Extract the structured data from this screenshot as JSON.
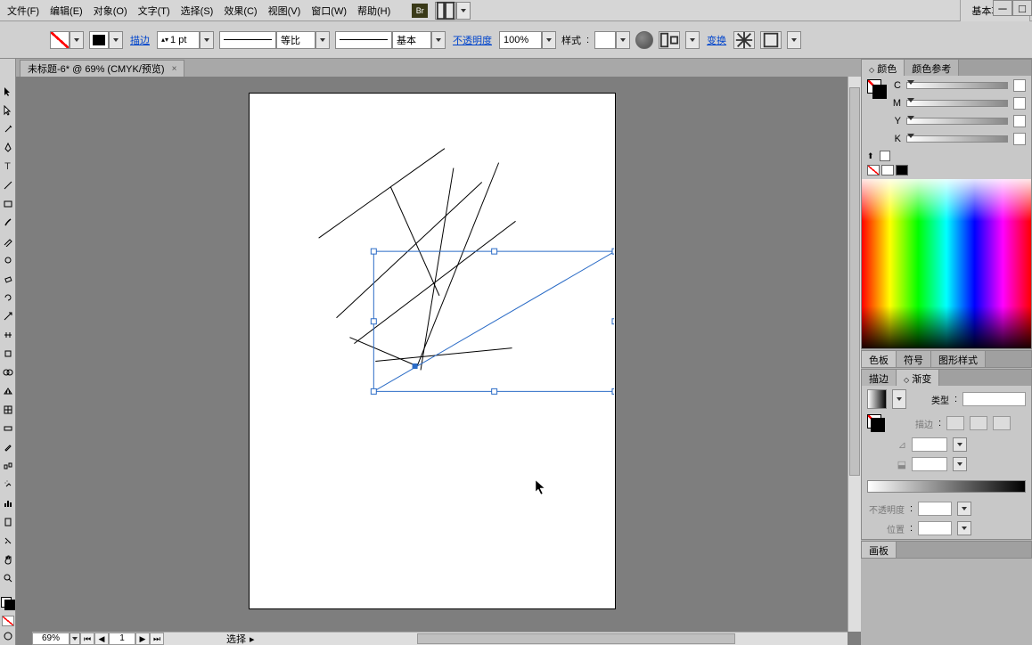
{
  "menu": [
    "文件(F)",
    "编辑(E)",
    "对象(O)",
    "文字(T)",
    "选择(S)",
    "效果(C)",
    "视图(V)",
    "窗口(W)",
    "帮助(H)"
  ],
  "workspace": "基本功能",
  "options": {
    "stroke_label": "描边",
    "stroke_value": "1 pt",
    "ratio_label": "等比",
    "profile_label": "基本",
    "opacity_label": "不透明度",
    "opacity_value": "100%",
    "style_label": "样式",
    "transform_label": "变换"
  },
  "document": {
    "tab_title": "未标题-6* @ 69% (CMYK/预览)"
  },
  "status": {
    "zoom": "69%",
    "page": "1",
    "selection_label": "选择"
  },
  "panels": {
    "color_tab": "颜色",
    "color_guide_tab": "颜色参考",
    "channels": [
      "C",
      "M",
      "Y",
      "K"
    ],
    "swatches_tab": "色板",
    "symbols_tab": "符号",
    "graphic_styles_tab": "图形样式",
    "stroke_tab": "描边",
    "gradient_tab": "渐变",
    "grad_type_label": "类型",
    "grad_stroke_label": "描边",
    "grad_opacity_label": "不透明度",
    "grad_position_label": "位置",
    "artboard_tab": "画板"
  }
}
